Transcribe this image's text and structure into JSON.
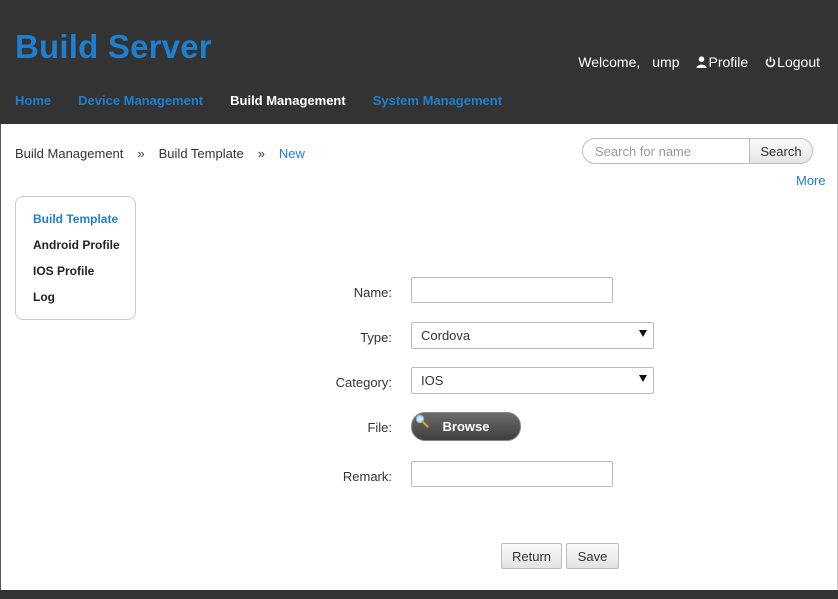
{
  "header": {
    "app_title": "Build Server",
    "welcome_label": "Welcome,",
    "username": "ump",
    "profile_label": "Profile",
    "logout_label": "Logout"
  },
  "nav": {
    "items": [
      {
        "label": "Home",
        "active": false
      },
      {
        "label": "Device Management",
        "active": false
      },
      {
        "label": "Build Management",
        "active": true
      },
      {
        "label": "System Management",
        "active": false
      }
    ]
  },
  "breadcrumb": {
    "items": [
      "Build Management",
      "Build Template",
      "New"
    ],
    "separator": "»"
  },
  "search": {
    "placeholder": "Search for name",
    "value": "",
    "button_label": "Search",
    "more_label": "More"
  },
  "sidebar": {
    "items": [
      {
        "label": "Build Template",
        "active": true
      },
      {
        "label": "Android Profile",
        "active": false
      },
      {
        "label": "IOS Profile",
        "active": false
      },
      {
        "label": "Log",
        "active": false
      }
    ]
  },
  "form": {
    "name_label": "Name:",
    "name_value": "",
    "type_label": "Type:",
    "type_value": "Cordova",
    "category_label": "Category:",
    "category_value": "IOS",
    "file_label": "File:",
    "browse_label": "Browse",
    "remark_label": "Remark:",
    "remark_value": ""
  },
  "actions": {
    "return_label": "Return",
    "save_label": "Save"
  },
  "colors": {
    "header_bg": "#333333",
    "accent": "#1e7fce"
  }
}
